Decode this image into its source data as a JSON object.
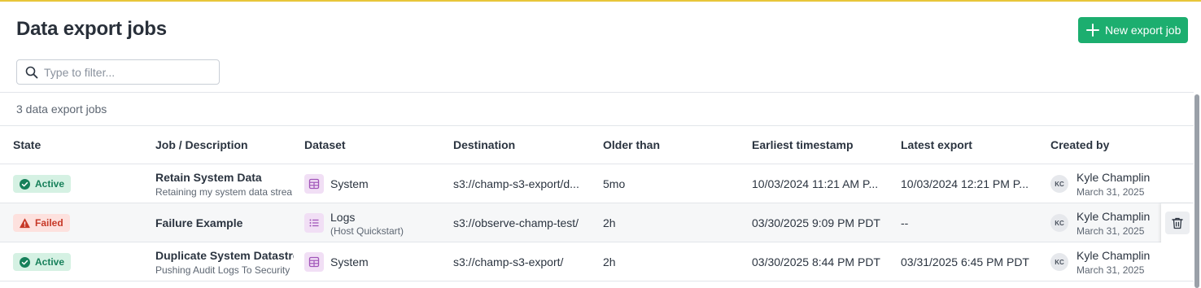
{
  "header": {
    "title": "Data export jobs",
    "new_button_label": "New export job"
  },
  "filter": {
    "placeholder": "Type to filter...",
    "value": ""
  },
  "summary": {
    "count_text": "3 data export jobs"
  },
  "table": {
    "columns": [
      "State",
      "Job / Description",
      "Dataset",
      "Destination",
      "Older than",
      "Earliest timestamp",
      "Latest export",
      "Created by"
    ],
    "rows": [
      {
        "state": "Active",
        "state_icon": "check-circle-icon",
        "job": "Retain System Data",
        "description": "Retaining my system data strea",
        "dataset": "System",
        "dataset_sub": "",
        "dataset_icon": "table-icon",
        "destination": "s3://champ-s3-export/d...",
        "older_than": "5mo",
        "earliest": "10/03/2024 11:21 AM P...",
        "latest": "10/03/2024 12:21 PM P...",
        "creator_initials": "KC",
        "creator": "Kyle Champlin",
        "created_date": "March 31, 2025"
      },
      {
        "state": "Failed",
        "state_icon": "warning-triangle-icon",
        "job": "Failure Example",
        "description": "",
        "dataset": "Logs",
        "dataset_sub": "(Host Quickstart)",
        "dataset_icon": "list-icon",
        "destination": "s3://observe-champ-test/",
        "older_than": "2h",
        "earliest": "03/30/2025 9:09 PM PDT",
        "latest": "--",
        "creator_initials": "KC",
        "creator": "Kyle Champlin",
        "created_date": "March 31, 2025"
      },
      {
        "state": "Active",
        "state_icon": "check-circle-icon",
        "job": "Duplicate System Datastre",
        "description": "Pushing Audit Logs To Security T",
        "dataset": "System",
        "dataset_sub": "",
        "dataset_icon": "table-icon",
        "destination": "s3://champ-s3-export/",
        "older_than": "2h",
        "earliest": "03/30/2025 8:44 PM PDT",
        "latest": "03/31/2025 6:45 PM PDT",
        "creator_initials": "KC",
        "creator": "Kyle Champlin",
        "created_date": "March 31, 2025"
      }
    ]
  },
  "colors": {
    "accent_bar": "#e8c63a",
    "primary_button": "#1cae6f",
    "active_badge_bg": "#d5f1e3",
    "active_badge_text": "#17805a",
    "failed_badge_bg": "#fde1de",
    "failed_badge_text": "#c73827",
    "dataset_icon_bg": "#f1dff5",
    "dataset_icon_fg": "#a155b9"
  },
  "row_actions": {
    "delete_icon": "trash-icon"
  }
}
